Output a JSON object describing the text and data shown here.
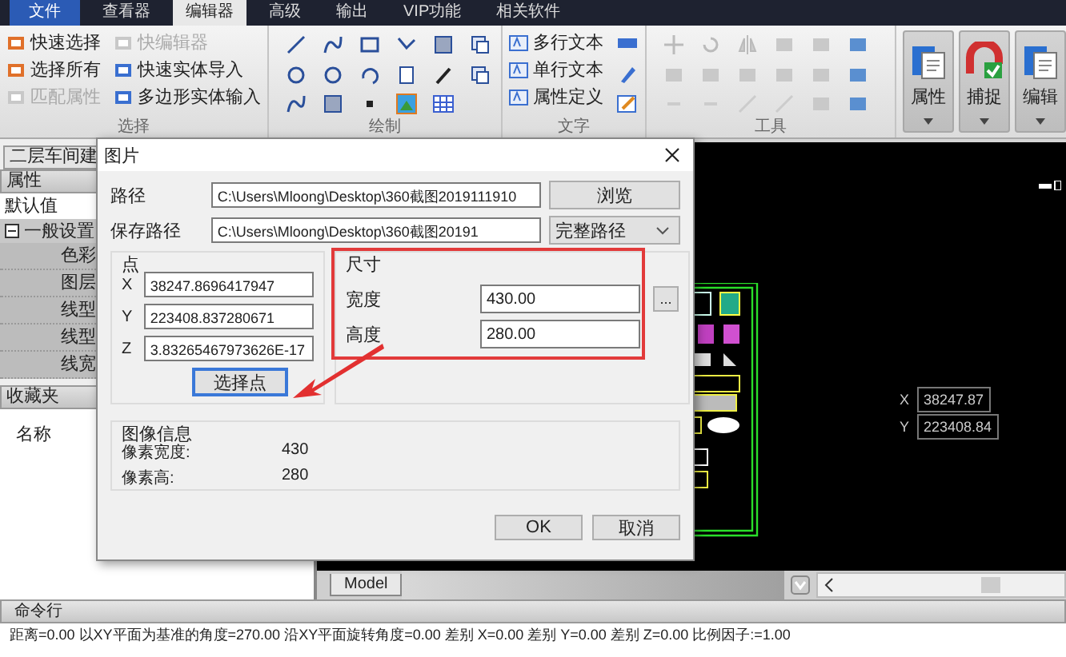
{
  "menu_tabs": [
    {
      "label": "文件",
      "kind": "file",
      "selected": false
    },
    {
      "label": "查看器",
      "kind": "tab",
      "selected": false
    },
    {
      "label": "编辑器",
      "kind": "tab",
      "selected": true
    },
    {
      "label": "高级",
      "kind": "tab",
      "selected": false
    },
    {
      "label": "输出",
      "kind": "tab",
      "selected": false
    },
    {
      "label": "VIP功能",
      "kind": "tab",
      "selected": false
    },
    {
      "label": "相关软件",
      "kind": "tab",
      "selected": false
    }
  ],
  "ribbon": {
    "select_group": {
      "title": "选择",
      "columns": [
        [
          {
            "label": "快速选择",
            "disabled": false
          },
          {
            "label": "选择所有",
            "disabled": false
          },
          {
            "label": "匹配属性",
            "disabled": true
          }
        ],
        [
          {
            "label": "快编辑器",
            "disabled": true
          },
          {
            "label": "快速实体导入",
            "disabled": false
          },
          {
            "label": "多边形实体输入",
            "disabled": false
          }
        ]
      ]
    },
    "draw_group": {
      "title": "绘制"
    },
    "text_group": {
      "title": "文字",
      "items": [
        {
          "label": "多行文本"
        },
        {
          "label": "单行文本"
        },
        {
          "label": "属性定义"
        }
      ]
    },
    "tools_group": {
      "title": "工具"
    },
    "big_buttons": [
      {
        "label": "属性"
      },
      {
        "label": "捕捉"
      },
      {
        "label": "编辑"
      }
    ]
  },
  "properties_panel": {
    "document_tab": "二层车间建",
    "header": "属性",
    "default_label": "默认值",
    "section": {
      "label": "一般设置",
      "expanded": true,
      "children": [
        {
          "label": "色彩"
        },
        {
          "label": "图层"
        },
        {
          "label": "线型"
        },
        {
          "label": "线型"
        },
        {
          "label": "线宽"
        }
      ]
    },
    "favorites_header": "收藏夹",
    "favorites_column": "名称"
  },
  "drawing": {
    "coords": [
      {
        "axis": "X",
        "value": "38247.87"
      },
      {
        "axis": "Y",
        "value": "223408.84"
      }
    ],
    "layout_tab": "Model"
  },
  "dialog": {
    "title": "图片",
    "path_label": "路径",
    "path_value": "C:\\Users\\Mloong\\Desktop\\360截图2019111910",
    "browse_button": "浏览",
    "save_label": "保存路径",
    "save_value": "C:\\Users\\Mloong\\Desktop\\360截图20191",
    "save_mode": "完整路径",
    "point": {
      "title": "点",
      "fields": [
        {
          "axis": "X",
          "value": "38247.8696417947"
        },
        {
          "axis": "Y",
          "value": "223408.837280671"
        },
        {
          "axis": "Z",
          "value": "3.83265467973626E-17"
        }
      ],
      "pick_button": "选择点"
    },
    "size": {
      "title": "尺寸",
      "width_label": "宽度",
      "width_value": "430.00",
      "height_label": "高度",
      "height_value": "280.00",
      "more_button": "..."
    },
    "info": {
      "title": "图像信息",
      "rows": [
        {
          "label": "像素宽度:",
          "value": "430"
        },
        {
          "label": "像素高:",
          "value": "280"
        }
      ]
    },
    "buttons": [
      "OK",
      "取消"
    ]
  },
  "command_line": {
    "title": "命令行",
    "output": "距离=0.00 以XY平面为基准的角度=270.00 沿XY平面旋转角度=0.00 差别 X=0.00 差别 Y=0.00 差别 Z=0.00 比例因子:=1.00"
  }
}
